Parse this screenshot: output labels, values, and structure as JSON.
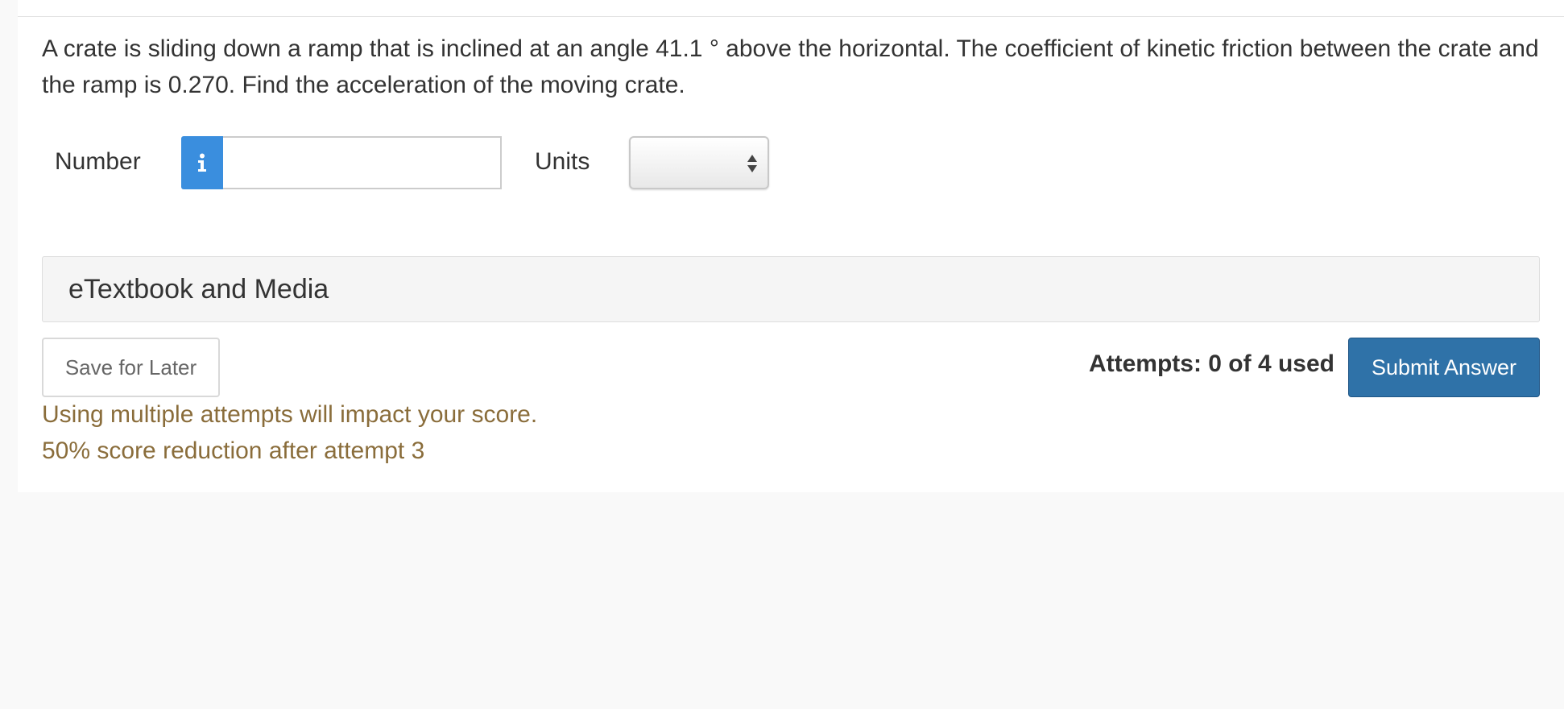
{
  "question": {
    "text": "A crate is sliding down a ramp that is inclined at an angle 41.1 ° above the horizontal. The coefficient of kinetic friction between the crate and the ramp is 0.270. Find the acceleration of the moving crate."
  },
  "answer": {
    "number_label": "Number",
    "number_value": "",
    "info_icon": "info-icon",
    "units_label": "Units",
    "units_selected": "",
    "units_arrows_icon": "sort-arrows-icon"
  },
  "etextbook": {
    "title": "eTextbook and Media"
  },
  "actions": {
    "save_label": "Save for Later",
    "attempts_text": "Attempts: 0 of 4 used",
    "submit_label": "Submit Answer"
  },
  "warnings": {
    "line1": "Using multiple attempts will impact your score.",
    "line2": "50% score reduction after attempt 3"
  },
  "colors": {
    "info_addon": "#3a8ede",
    "submit_button": "#2f72a8",
    "warning_text": "#8a6d3b",
    "panel_background": "#f5f5f5"
  }
}
